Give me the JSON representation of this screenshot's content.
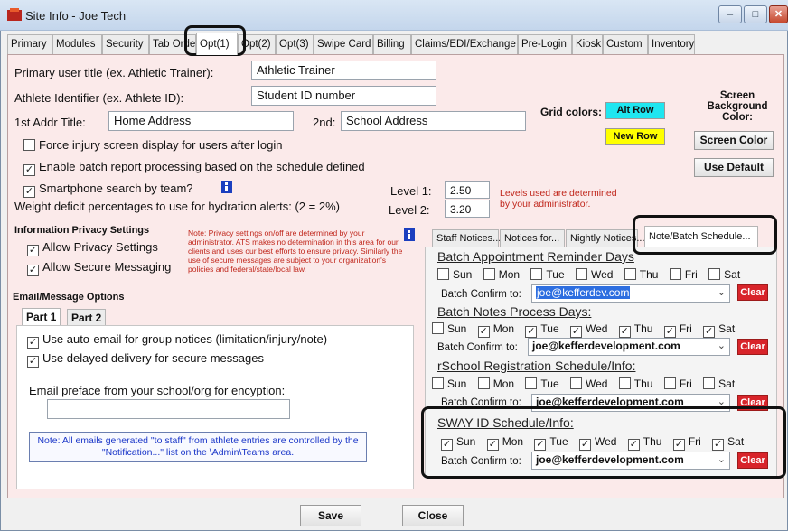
{
  "window": {
    "title": "Site Info - Joe Tech",
    "min": "–",
    "max": "□",
    "close": "✕"
  },
  "tabs": [
    "Primary",
    "Modules",
    "Security",
    "Tab Order",
    "Opt(1)",
    "Opt(2)",
    "Opt(3)",
    "Swipe Card",
    "Billing",
    "Claims/EDI/Exchange",
    "Pre-Login",
    "Kiosk",
    "Custom",
    "Inventory"
  ],
  "top": {
    "primary_title_label": "Primary user title (ex. Athletic Trainer):",
    "primary_title_value": "Athletic Trainer",
    "athlete_id_label": "Athlete Identifier (ex. Athlete ID):",
    "athlete_id_value": "Student ID number",
    "addr1_label": "1st Addr Title:",
    "addr1_value": "Home Address",
    "addr2_label": "2nd:",
    "addr2_value": "School Address",
    "grid_colors_label": "Grid colors:",
    "alt_row": "Alt Row",
    "new_row": "New Row",
    "screen_bg_label": "Screen Background Color:",
    "screen_color_btn": "Screen Color",
    "use_default_btn": "Use Default",
    "force_injury": "Force injury screen display for users after login",
    "batch_report": "Enable batch report processing based on the schedule defined",
    "smartphone": "Smartphone search by team?",
    "weight_label": "Weight deficit percentages to use for hydration alerts:  (2 = 2%)",
    "level1_label": "Level 1:",
    "level1_value": "2.50",
    "level2_label": "Level 2:",
    "level2_value": "3.20",
    "levels_note": "Levels used are determined by your administrator."
  },
  "privacy": {
    "title": "Information Privacy Settings",
    "allow_privacy": "Allow Privacy Settings",
    "allow_secure": "Allow Secure Messaging",
    "note": "Note:  Privacy settings on/off are determined by your administrator.  ATS makes no determination in this area for our clients and uses our best efforts to ensure privacy. Similarly the use of secure messages are subject to your organization's policies and federal/state/local law."
  },
  "email": {
    "title": "Email/Message Options",
    "tab1": "Part 1",
    "tab2": "Part 2",
    "auto_email": "Use auto-email for group notices (limitation/injury/note)",
    "delayed": "Use delayed delivery for secure messages",
    "preface_label": "Email preface from your school/org for encyption:",
    "preface_value": "",
    "note": "Note:  All emails generated \"to staff\" from athlete entries are controlled by the \"Notification...\" list on the \\Admin\\Teams area."
  },
  "notice_tabs": [
    "Staff Notices...",
    "Notices for...",
    "Nightly Notices...",
    "Note/Batch Schedule..."
  ],
  "schedules": {
    "day_names": [
      "Sun",
      "Mon",
      "Tue",
      "Wed",
      "Thu",
      "Fri",
      "Sat"
    ],
    "confirm_label": "Batch Confirm to:",
    "clear": "Clear",
    "items": [
      {
        "title": "Batch Appointment Reminder Days",
        "days": [
          false,
          false,
          false,
          false,
          false,
          false,
          false
        ],
        "email": "joe@kefferdev.com"
      },
      {
        "title": "Batch Notes Process Days:",
        "days": [
          false,
          true,
          true,
          true,
          true,
          true,
          true
        ],
        "email": "joe@kefferdevelopment.com"
      },
      {
        "title": "rSchool Registration Schedule/Info:",
        "days": [
          false,
          false,
          false,
          false,
          false,
          false,
          false
        ],
        "email": "joe@kefferdevelopment.com"
      },
      {
        "title": "SWAY ID Schedule/Info:",
        "days": [
          true,
          true,
          true,
          true,
          true,
          true,
          true
        ],
        "email": "joe@kefferdevelopment.com"
      }
    ]
  },
  "footer": {
    "save": "Save",
    "close": "Close"
  },
  "colors": {
    "panel_bg": "#fbeaea",
    "alt_row": "#1fe6f0",
    "new_row": "#ffff00",
    "clear_red": "#d8242a",
    "note_red": "#c0271c",
    "note_blue": "#1a36c8"
  }
}
